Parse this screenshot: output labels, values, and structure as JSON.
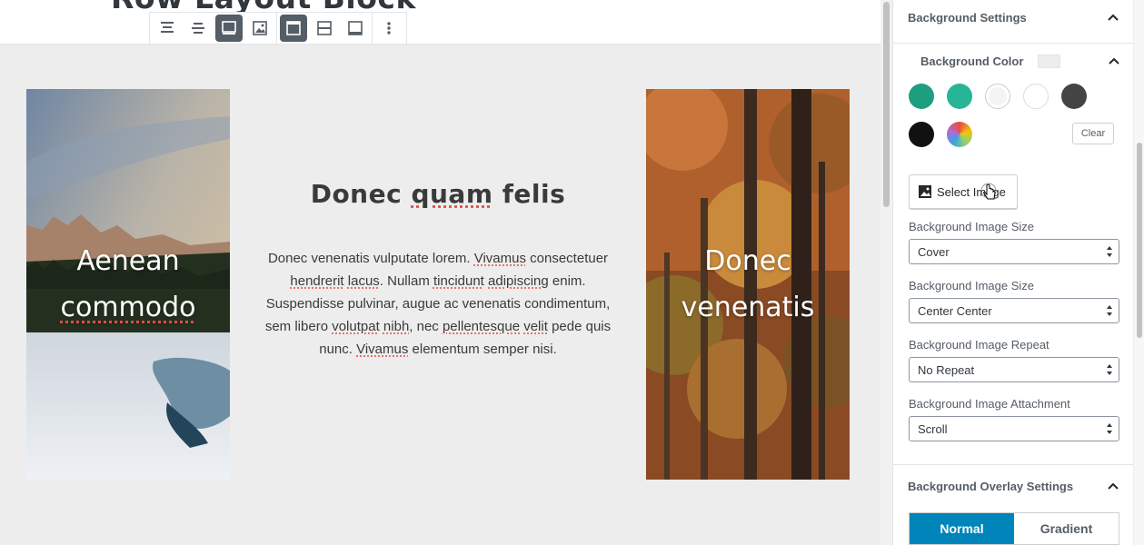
{
  "editor": {
    "block_title": "Row Layout Block",
    "left_column": {
      "caption_line1": "Aenean",
      "caption_line2": "commodo"
    },
    "center_column": {
      "heading_pre": "Donec ",
      "heading_spell": "quam",
      "heading_post": " felis",
      "paragraph": [
        {
          "t": "Donec venenatis vulputate lorem. "
        },
        {
          "t": "Vivamus",
          "spell": true
        },
        {
          "t": " consectetuer "
        },
        {
          "t": "hendrerit",
          "spell": true
        },
        {
          "t": " "
        },
        {
          "t": "lacus",
          "spell": true
        },
        {
          "t": ". Nullam "
        },
        {
          "t": "tincidunt",
          "spell": true
        },
        {
          "t": " "
        },
        {
          "t": "adipiscing",
          "spell": true
        },
        {
          "t": " enim. Suspendisse pulvinar, augue ac venenatis condimentum, sem libero "
        },
        {
          "t": "volutpat",
          "spell": true
        },
        {
          "t": " "
        },
        {
          "t": "nibh",
          "spell": true
        },
        {
          "t": ", nec "
        },
        {
          "t": "pellentesque",
          "spell": true
        },
        {
          "t": " "
        },
        {
          "t": "velit",
          "spell": true
        },
        {
          "t": " pede quis nunc. "
        },
        {
          "t": "Vivamus",
          "spell": true
        },
        {
          "t": " elementum semper nisi."
        }
      ]
    },
    "right_column": {
      "caption_line1": "Donec",
      "caption_line2": "venenatis"
    },
    "toolbar": [
      {
        "name": "align-top-icon",
        "active": false
      },
      {
        "name": "align-center-icon",
        "active": false
      },
      {
        "name": "align-bottom-icon",
        "active": true
      },
      {
        "name": "image-icon",
        "active": false
      },
      {
        "name": "top-divider-icon",
        "active": true
      },
      {
        "name": "middle-divider-icon",
        "active": false
      },
      {
        "name": "bottom-divider-icon",
        "active": false
      },
      {
        "name": "more-options-icon",
        "active": false
      }
    ]
  },
  "sidebar": {
    "background_settings_title": "Background Settings",
    "background_color_label": "Background Color",
    "swatches": [
      {
        "name": "swatch-green",
        "color": "#1e9e7f"
      },
      {
        "name": "swatch-teal",
        "color": "#28b597"
      },
      {
        "name": "swatch-light-gray",
        "color": "#f4f4f4"
      },
      {
        "name": "swatch-white",
        "color": "#ffffff"
      },
      {
        "name": "swatch-dark-gray",
        "color": "#444444"
      },
      {
        "name": "swatch-black",
        "color": "#111111"
      },
      {
        "name": "swatch-custom",
        "color": "gradient"
      }
    ],
    "clear_label": "Clear",
    "select_image_label": "Select Image",
    "fields": [
      {
        "label": "Background Image Size",
        "value": "Cover"
      },
      {
        "label": "Background Image Size",
        "value": "Center Center"
      },
      {
        "label": "Background Image Repeat",
        "value": "No Repeat"
      },
      {
        "label": "Background Image Attachment",
        "value": "Scroll"
      }
    ],
    "overlay_title": "Background Overlay Settings",
    "overlay_tabs": [
      "Normal",
      "Gradient"
    ],
    "active_tab": "Normal"
  }
}
